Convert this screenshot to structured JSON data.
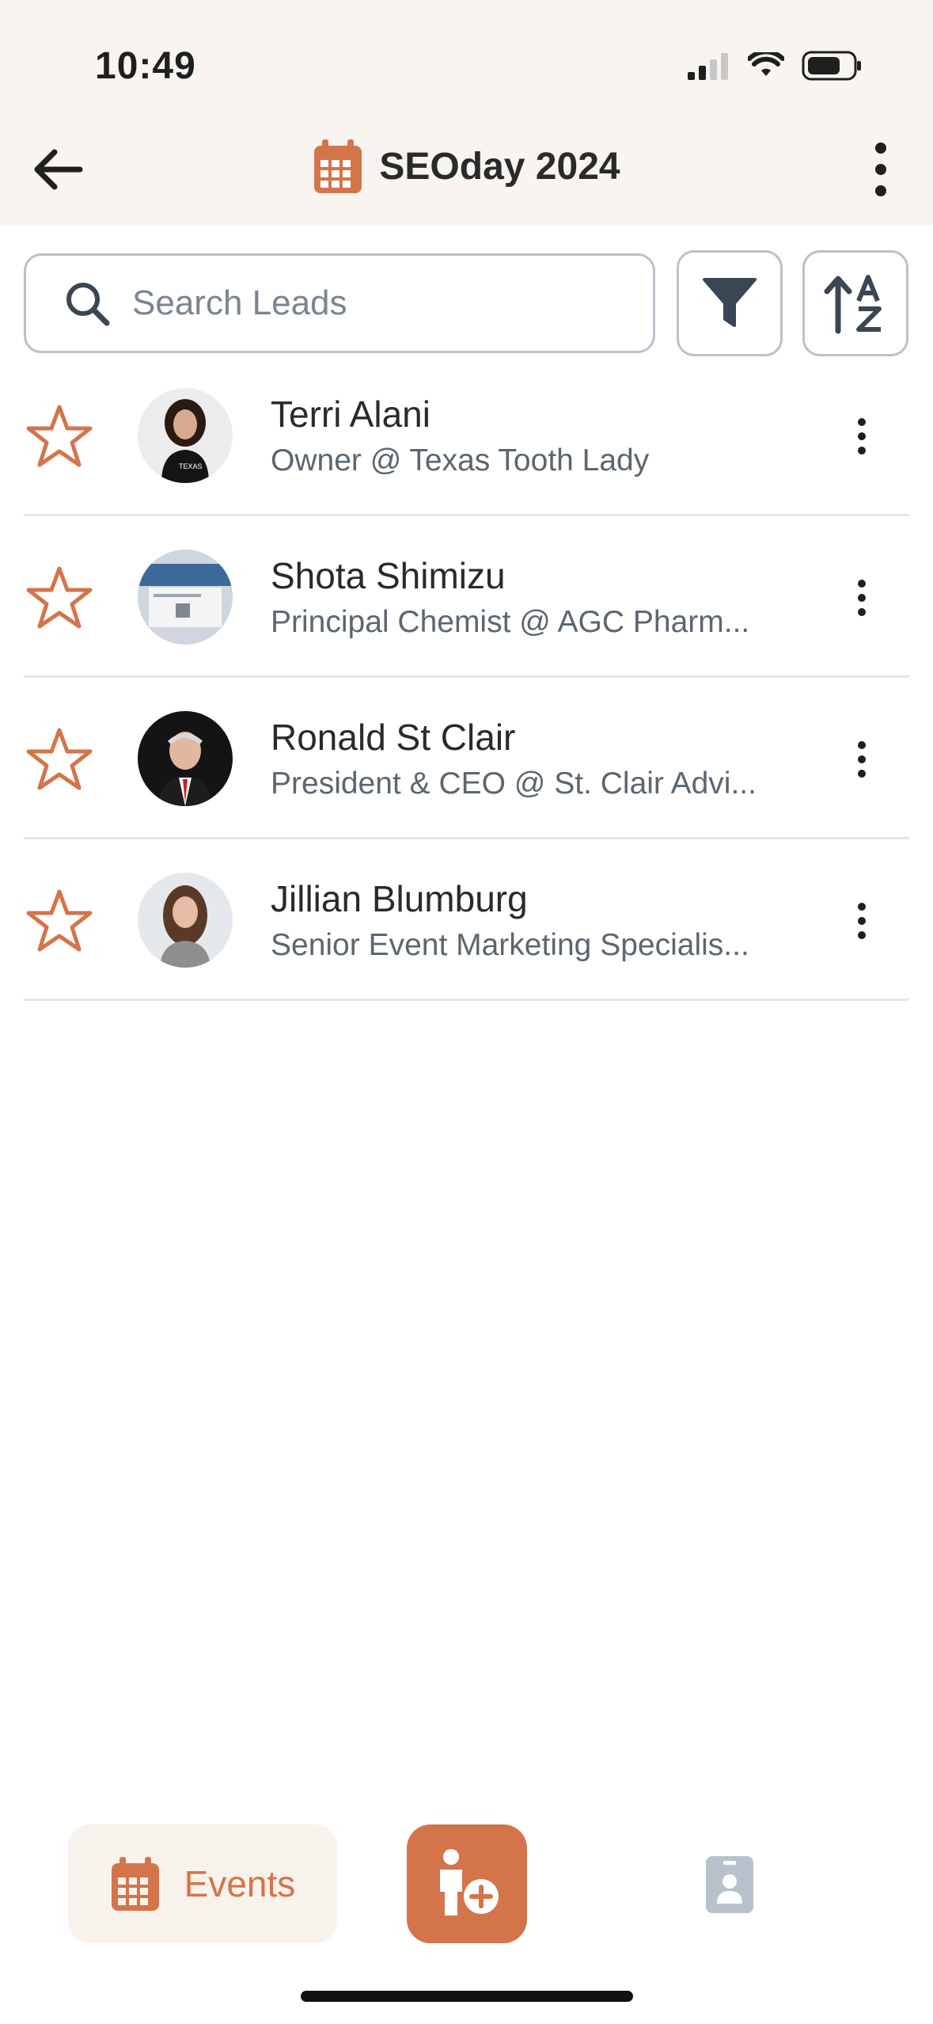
{
  "status": {
    "time": "10:49"
  },
  "header": {
    "title": "SEOday 2024"
  },
  "search": {
    "placeholder": "Search Leads"
  },
  "leads": [
    {
      "name": "Terri Alani",
      "subtitle": "Owner @ Texas Tooth Lady"
    },
    {
      "name": "Shota Shimizu",
      "subtitle": "Principal Chemist @ AGC Pharm..."
    },
    {
      "name": "Ronald St Clair",
      "subtitle": "President & CEO @ St. Clair Advi..."
    },
    {
      "name": "Jillian Blumburg",
      "subtitle": "Senior Event Marketing Specialis..."
    }
  ],
  "bottom_nav": {
    "events_label": "Events"
  },
  "colors": {
    "accent": "#d4744a",
    "header_bg": "#f8f4f0",
    "muted_icon": "#b9c2cc"
  },
  "icons": [
    "calendar-icon",
    "back-arrow-icon",
    "more-vertical-icon",
    "search-icon",
    "filter-icon",
    "sort-az-icon",
    "star-outline-icon",
    "add-person-icon",
    "contact-card-icon"
  ]
}
